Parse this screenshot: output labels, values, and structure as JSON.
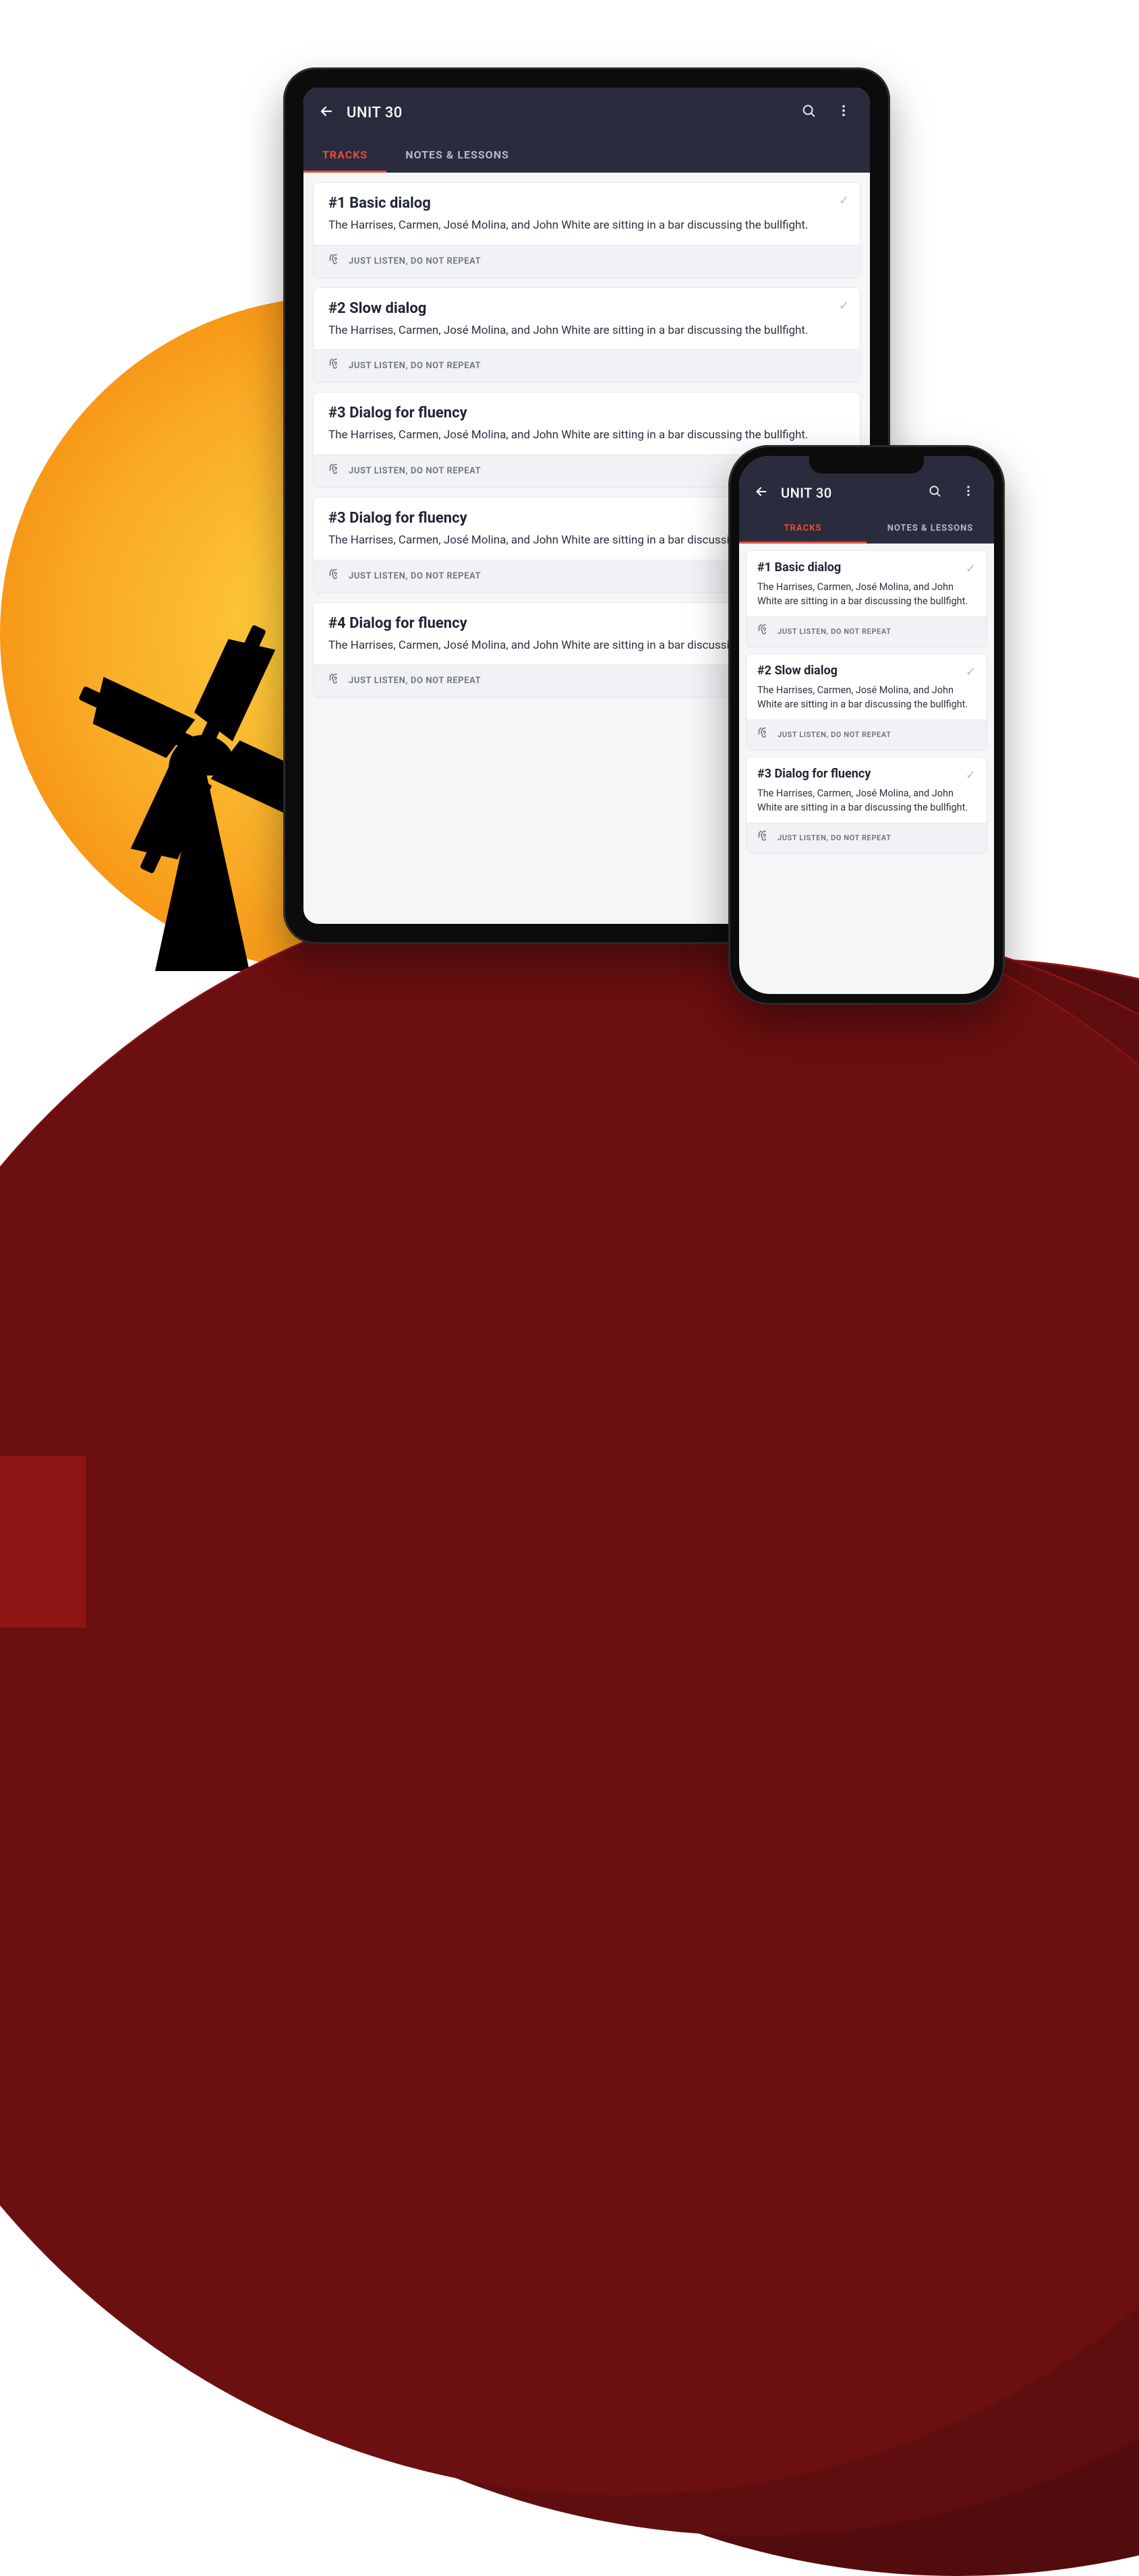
{
  "colors": {
    "accent": "#e74c3c",
    "headerBg": "#2a2b3d",
    "cardBg": "#ffffff",
    "pageBg": "#f5f6f8",
    "hill": "#6b0f10",
    "sunInner": "#ffd23f",
    "sunOuter": "#f57c00"
  },
  "header": {
    "title": "UNIT 30",
    "backIcon": "←",
    "searchIcon": "search-icon",
    "moreIcon": "more-vert-icon"
  },
  "tabs": [
    {
      "label": "TRACKS",
      "active": true
    },
    {
      "label": "NOTES & LESSONS",
      "active": false
    }
  ],
  "hint": {
    "text": "JUST LISTEN, DO NOT REPEAT",
    "icon": "ear-listen-icon"
  },
  "common": {
    "description": "The Harrises, Carmen, José Molina, and John White are sitting in a bar discussing the bullfight.",
    "checkIcon": "✓"
  },
  "tablet": {
    "tracks": [
      {
        "title": "#1 Basic dialog",
        "completed": true
      },
      {
        "title": "#2 Slow dialog",
        "completed": true
      },
      {
        "title": "#3 Dialog for fluency",
        "completed": false
      },
      {
        "title": "#3 Dialog for fluency",
        "completed": false
      },
      {
        "title": "#4 Dialog for fluency",
        "completed": false
      }
    ]
  },
  "phone": {
    "tracks": [
      {
        "title": "#1 Basic dialog",
        "completed": true
      },
      {
        "title": "#2 Slow dialog",
        "completed": true
      },
      {
        "title": "#3 Dialog for fluency",
        "completed": true
      }
    ]
  }
}
